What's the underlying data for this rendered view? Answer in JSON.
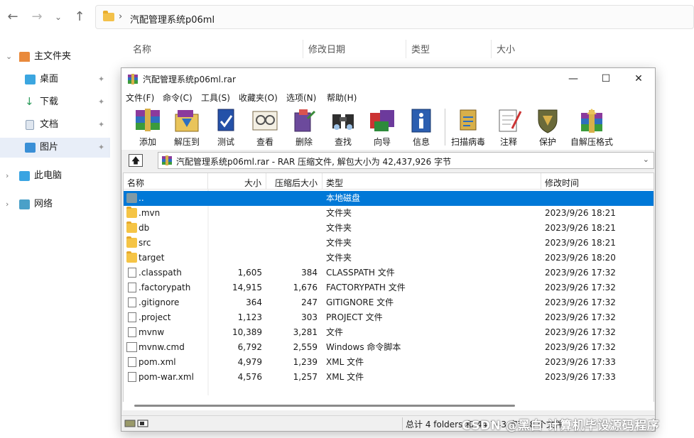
{
  "explorer": {
    "address_crumb": "汽配管理系统p06ml",
    "sidebar": [
      {
        "label": "主文件夹"
      },
      {
        "label": "桌面"
      },
      {
        "label": "下载"
      },
      {
        "label": "文档"
      },
      {
        "label": "图片"
      },
      {
        "label": "此电脑"
      },
      {
        "label": "网络"
      }
    ],
    "columns": [
      "名称",
      "修改日期",
      "类型",
      "大小"
    ]
  },
  "rar": {
    "title": "汽配管理系统p06ml.rar",
    "window_buttons": {
      "minimize": "—",
      "maximize": "☐",
      "close": "✕"
    },
    "menu": [
      "文件(F)",
      "命令(C)",
      "工具(S)",
      "收藏夹(O)",
      "选项(N)",
      "帮助(H)"
    ],
    "toolbar": [
      {
        "label": "添加",
        "icon": "add-icon"
      },
      {
        "label": "解压到",
        "icon": "extract-to-icon"
      },
      {
        "label": "测试",
        "icon": "test-icon"
      },
      {
        "label": "查看",
        "icon": "view-icon"
      },
      {
        "label": "删除",
        "icon": "delete-icon"
      },
      {
        "label": "查找",
        "icon": "find-icon"
      },
      {
        "label": "向导",
        "icon": "wizard-icon"
      },
      {
        "label": "信息",
        "icon": "info-icon"
      },
      {
        "label": "扫描病毒",
        "icon": "virus-scan-icon"
      },
      {
        "label": "注释",
        "icon": "comment-icon"
      },
      {
        "label": "保护",
        "icon": "protect-icon"
      },
      {
        "label": "自解压格式",
        "icon": "sfx-icon"
      }
    ],
    "path": "汽配管理系统p06ml.rar - RAR 压缩文件, 解包大小为 42,437,926 字节",
    "columns": [
      "名称",
      "大小",
      "压缩后大小",
      "类型",
      "修改时间"
    ],
    "rows": [
      {
        "name": "..",
        "size": "",
        "packed": "",
        "type": "本地磁盘",
        "time": "",
        "kind": "updir"
      },
      {
        "name": ".mvn",
        "size": "",
        "packed": "",
        "type": "文件夹",
        "time": "2023/9/26 18:21",
        "kind": "folder"
      },
      {
        "name": "db",
        "size": "",
        "packed": "",
        "type": "文件夹",
        "time": "2023/9/26 18:21",
        "kind": "folder"
      },
      {
        "name": "src",
        "size": "",
        "packed": "",
        "type": "文件夹",
        "time": "2023/9/26 18:21",
        "kind": "folder"
      },
      {
        "name": "target",
        "size": "",
        "packed": "",
        "type": "文件夹",
        "time": "2023/9/26 18:20",
        "kind": "folder"
      },
      {
        "name": ".classpath",
        "size": "1,605",
        "packed": "384",
        "type": "CLASSPATH 文件",
        "time": "2023/9/26 17:32",
        "kind": "file"
      },
      {
        "name": ".factorypath",
        "size": "14,915",
        "packed": "1,676",
        "type": "FACTORYPATH 文件",
        "time": "2023/9/26 17:32",
        "kind": "file"
      },
      {
        "name": ".gitignore",
        "size": "364",
        "packed": "247",
        "type": "GITIGNORE 文件",
        "time": "2023/9/26 17:32",
        "kind": "file"
      },
      {
        "name": ".project",
        "size": "1,123",
        "packed": "303",
        "type": "PROJECT 文件",
        "time": "2023/9/26 17:32",
        "kind": "file"
      },
      {
        "name": "mvnw",
        "size": "10,389",
        "packed": "3,281",
        "type": "文件",
        "time": "2023/9/26 17:32",
        "kind": "file"
      },
      {
        "name": "mvnw.cmd",
        "size": "6,792",
        "packed": "2,559",
        "type": "Windows 命令脚本",
        "time": "2023/9/26 17:32",
        "kind": "cmd"
      },
      {
        "name": "pom.xml",
        "size": "4,979",
        "packed": "1,239",
        "type": "XML 文件",
        "time": "2023/9/26 17:33",
        "kind": "file"
      },
      {
        "name": "pom-war.xml",
        "size": "4,576",
        "packed": "1,257",
        "type": "XML 文件",
        "time": "2023/9/26 17:33",
        "kind": "file"
      }
    ],
    "status": "总计 4 folders 和 44,743 字节(8 个文件)"
  },
  "watermark": "CSDN @黑白 计算机毕设源码程序"
}
